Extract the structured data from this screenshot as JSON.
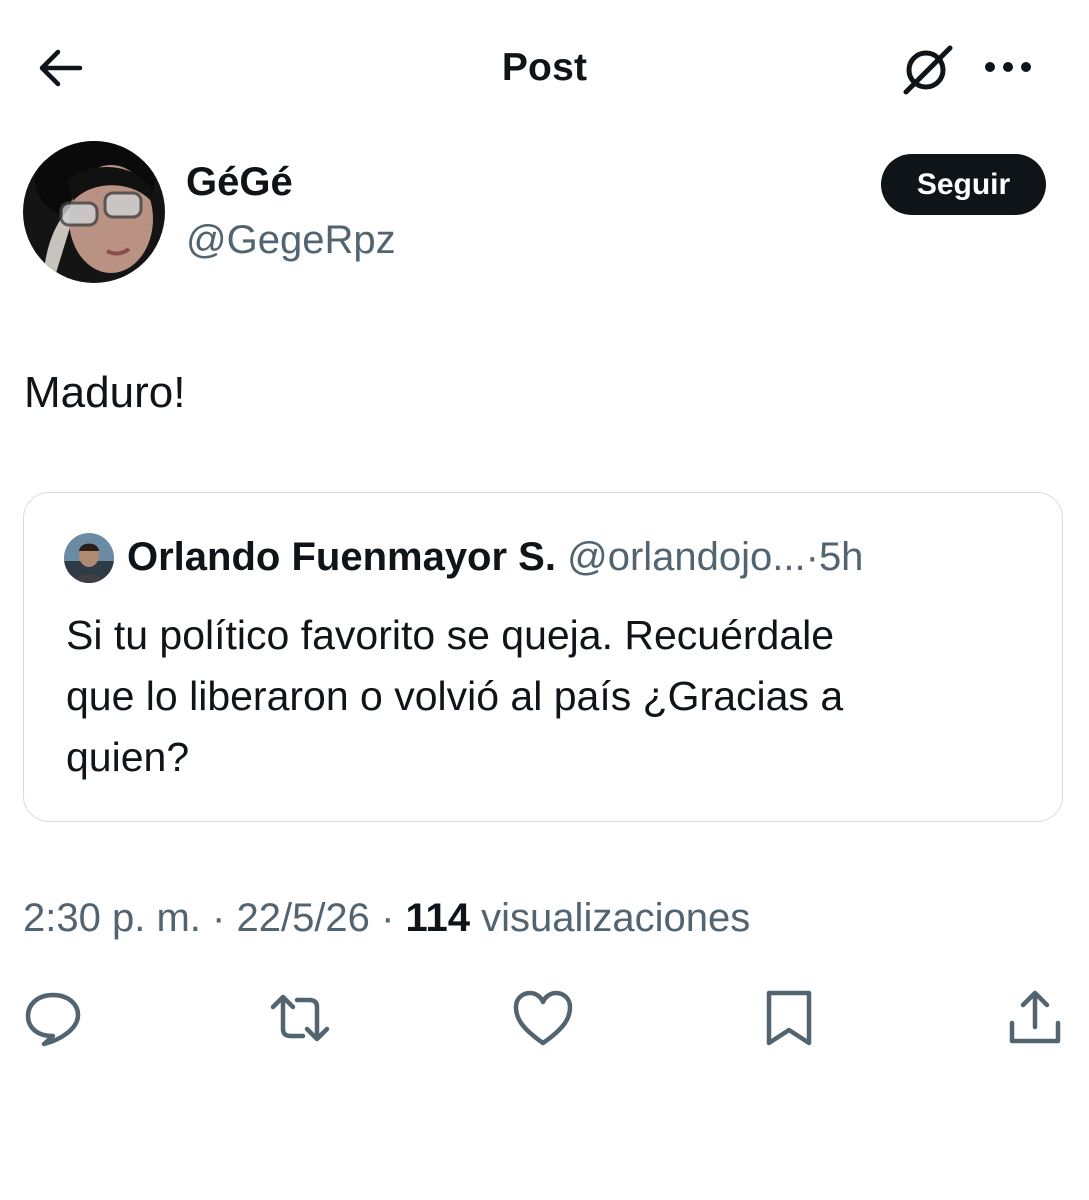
{
  "header": {
    "title": "Post",
    "back_icon": "arrow-left-icon",
    "grok_icon": "grok-icon",
    "more_icon": "more-horizontal-icon"
  },
  "author": {
    "display_name": "GéGé",
    "handle": "@GegeRpz",
    "follow_label": "Seguir"
  },
  "post": {
    "text": "Maduro!"
  },
  "quoted": {
    "display_name": "Orlando Fuenmayor S.",
    "handle": "@orlandojo...",
    "separator": "·",
    "time": "5h",
    "lines": [
      "Si tu político favorito se queja. Recuérdale",
      "que lo liberaron o volvió al país ¿Gracias a",
      "quien?"
    ]
  },
  "meta": {
    "time": "2:30",
    "ampm": "p. m.",
    "sep1": "·",
    "date": "22/5/26",
    "sep2": "·",
    "views_count": "114",
    "views_label": "visualizaciones"
  },
  "actions": [
    "reply-icon",
    "repost-icon",
    "like-icon",
    "bookmark-icon",
    "share-icon"
  ],
  "colors": {
    "text": "#0f1419",
    "secondary": "#536471",
    "border": "#d6dde2",
    "follow_bg": "#0f1419"
  }
}
